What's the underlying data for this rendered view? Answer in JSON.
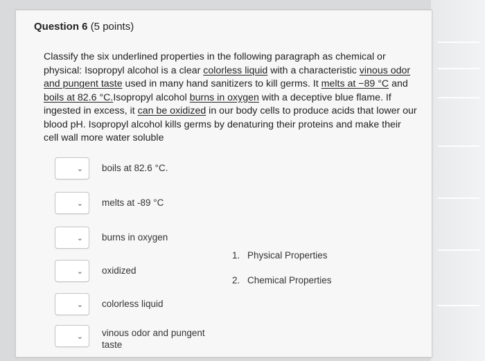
{
  "question": {
    "number_label": "Question 6",
    "points_label": "(5 points)"
  },
  "paragraph": {
    "s1": "Classify the six underlined properties in the following paragraph as chemical or physical: Isopropyl alcohol is a clear ",
    "u1": "colorless liquid",
    "s2": " with a characteristic ",
    "u2": "vinous odor and pungent taste",
    "s3": " used in many hand sanitizers to kill germs. It ",
    "u3": "melts at −89 °C",
    "s4": " and ",
    "u4": "boils at 82.6 °C.",
    "s5": "Isopropyl alcohol ",
    "u5": "burns in oxygen",
    "s6": " with a deceptive blue flame. If ingested in excess, it ",
    "u6": "can be oxidized",
    "s7": " in our body cells to produce acids that lower our blood pH. Isopropyl alcohol kills germs by denaturing their proteins and make their cell wall more water soluble"
  },
  "items": [
    {
      "label": "boils at 82.6 °C."
    },
    {
      "label": "melts at -89 °C"
    },
    {
      "label": "burns in oxygen"
    },
    {
      "label": "oxidized"
    },
    {
      "label": "colorless liquid"
    },
    {
      "label": "vinous odor and pungent taste"
    }
  ],
  "choices": [
    {
      "num": "1.",
      "label": "Physical Properties"
    },
    {
      "num": "2.",
      "label": "Chemical Properties"
    }
  ],
  "icons": {
    "dropdown": "chevron-down-icon"
  }
}
